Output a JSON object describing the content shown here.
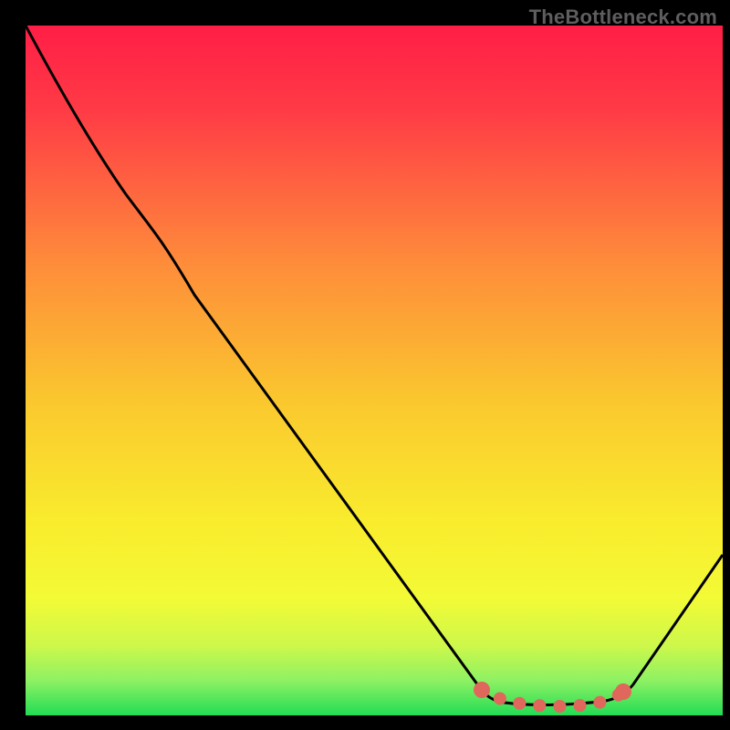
{
  "watermark": "TheBottleneck.com",
  "chart_data": {
    "type": "line",
    "title": "",
    "xlabel": "",
    "ylabel": "",
    "xlim": [
      0,
      100
    ],
    "ylim": [
      0,
      100
    ],
    "grid": false,
    "legend": false,
    "annotations": [
      {
        "text": "TheBottleneck.com",
        "position": "top-right"
      }
    ],
    "background_gradient": {
      "direction": "vertical",
      "stops": [
        {
          "t": 0.0,
          "color": "#FF1E46"
        },
        {
          "t": 0.35,
          "color": "#FE8E3A"
        },
        {
          "t": 0.72,
          "color": "#F9EC2D"
        },
        {
          "t": 1.0,
          "color": "#22DC55"
        }
      ]
    },
    "series": [
      {
        "name": "bottleneck_curve",
        "color": "#000000",
        "x": [
          0,
          5,
          10,
          14,
          20,
          30,
          40,
          50,
          60,
          65,
          70,
          75,
          80,
          83,
          86,
          90,
          100
        ],
        "y": [
          100,
          91,
          82,
          76,
          68,
          55,
          42,
          29,
          16,
          10,
          4,
          2,
          1,
          2,
          3,
          6,
          24
        ]
      }
    ],
    "highlighted_range": {
      "name": "optimal_zone_beads",
      "color": "#E0675C",
      "x": [
        65,
        68,
        71,
        74,
        77,
        80,
        83,
        86
      ],
      "y": [
        4,
        3,
        2,
        1,
        1,
        1,
        2,
        3
      ]
    }
  }
}
